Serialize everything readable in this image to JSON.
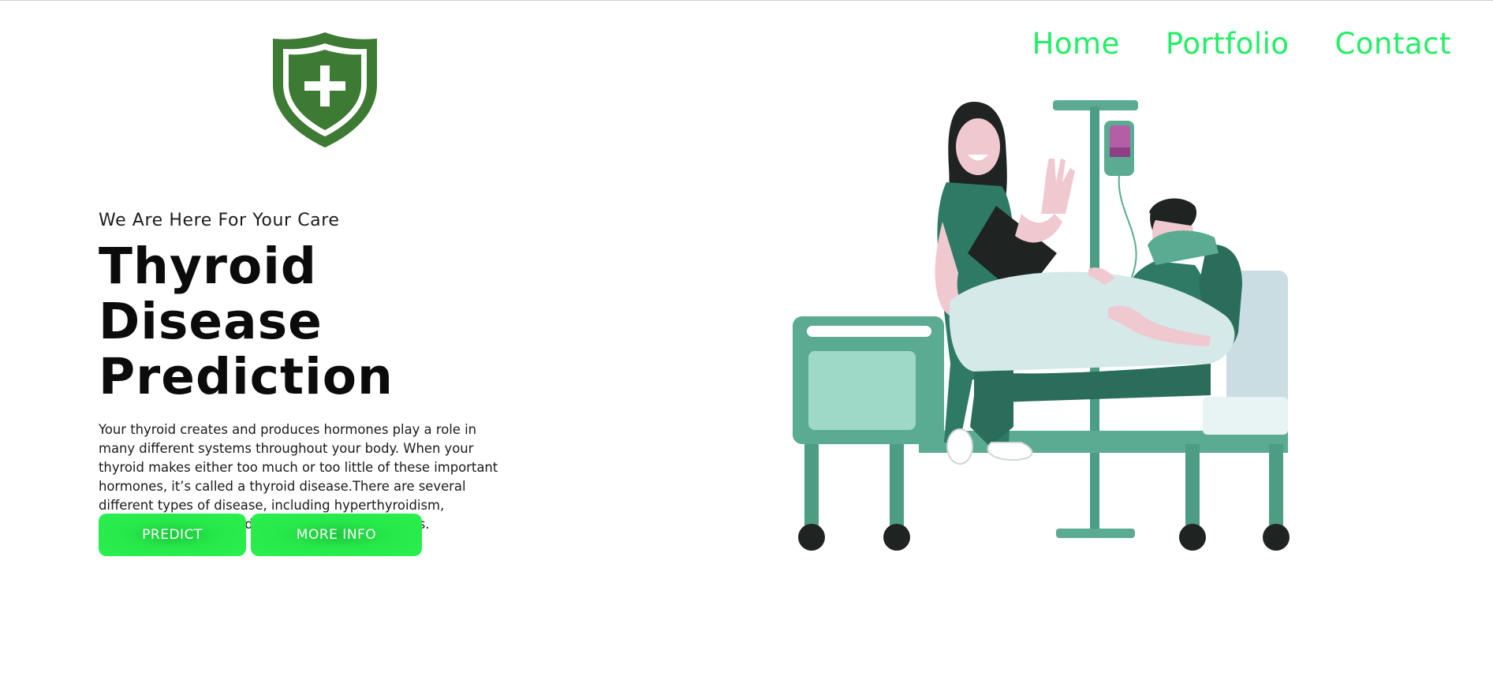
{
  "header": {
    "logo_icon": "shield-plus-icon",
    "nav": [
      {
        "label": "Home"
      },
      {
        "label": "Portfolio"
      },
      {
        "label": "Contact"
      }
    ]
  },
  "hero": {
    "tagline": "We Are Here For Your Care",
    "title_line1": "Thyroid Disease",
    "title_line2": "Prediction",
    "description": "Your thyroid creates and produces hormones play a role in many different systems throughout your body. When your thyroid makes either too much or too little of these important hormones, it’s called a thyroid disease.There are several different types of disease, including hyperthyroidism, hypothyroidism, thyroiditis Hashimoto’s thyroiditis.",
    "buttons": {
      "predict": "PREDICT",
      "more_info": "MORE INFO"
    }
  },
  "illustration": {
    "name": "nurse-patient-hospital-bed-illustration"
  },
  "colors": {
    "nav_text": "#22ee66",
    "button_green": "#2bf04f",
    "logo_green": "#3d7a33",
    "scrubs_green": "#2e7a65",
    "bed_green": "#5aab92"
  }
}
